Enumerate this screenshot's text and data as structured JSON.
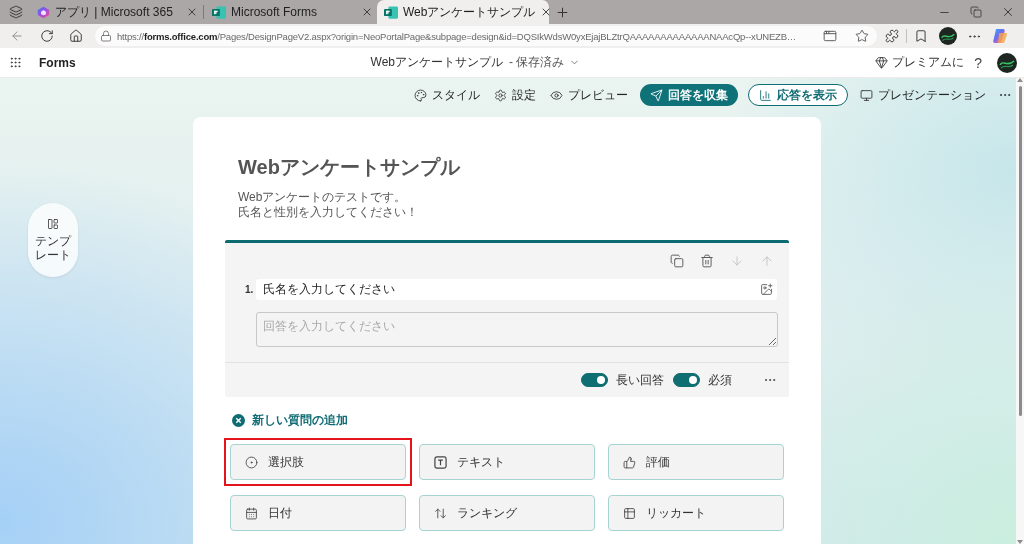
{
  "browser": {
    "tabs": [
      {
        "title": "アプリ | Microsoft 365",
        "selected": false
      },
      {
        "title": "Microsoft Forms",
        "selected": false
      },
      {
        "title": "Webアンケートサンプル",
        "selected": true
      }
    ],
    "url": "https://**forms.office.com**/Pages/DesignPageV2.aspx?origin=NeoPortalPage&subpage=design&id=DQSIkWdsW0yxEjajBLZtrQAAAAAAAAAAAAANAAcQp--xUNEZB…"
  },
  "app_header": {
    "app_name": "Forms",
    "doc_title": "Webアンケートサンプル",
    "save_status": "- 保存済み",
    "premium": "プレミアムに",
    "help": "?"
  },
  "toolbar": {
    "items": [
      {
        "kind": "plain",
        "label": "スタイル"
      },
      {
        "kind": "plain",
        "label": "設定"
      },
      {
        "kind": "plain",
        "label": "プレビュー"
      },
      {
        "kind": "primary",
        "label": "回答を収集"
      },
      {
        "kind": "outline",
        "label": "応答を表示"
      },
      {
        "kind": "plain",
        "label": "プレゼンテーション"
      }
    ]
  },
  "sidebar": {
    "templates": "テンプレート"
  },
  "form": {
    "title": "Webアンケートサンプル",
    "description": [
      "Webアンケートのテストです。",
      "氏名と性別を入力してください！"
    ]
  },
  "question": {
    "number": "1.",
    "text": "氏名を入力してください",
    "answer_placeholder": "回答を入力してください",
    "tools": [
      {
        "kind": "copy",
        "disabled": false
      },
      {
        "kind": "delete",
        "disabled": false
      },
      {
        "kind": "move_down",
        "disabled": true
      },
      {
        "kind": "move_up",
        "disabled": true
      }
    ],
    "options": [
      {
        "label": "長い回答",
        "on": true
      },
      {
        "label": "必須",
        "on": true
      }
    ]
  },
  "add_question": {
    "label": "新しい質問の追加",
    "types": [
      {
        "label": "選択肢",
        "highlighted": true
      },
      {
        "label": "テキスト",
        "highlighted": false
      },
      {
        "label": "評価",
        "highlighted": false
      },
      {
        "label": "日付",
        "highlighted": false
      },
      {
        "label": "ランキング",
        "highlighted": false
      },
      {
        "label": "リッカート",
        "highlighted": false
      }
    ]
  }
}
